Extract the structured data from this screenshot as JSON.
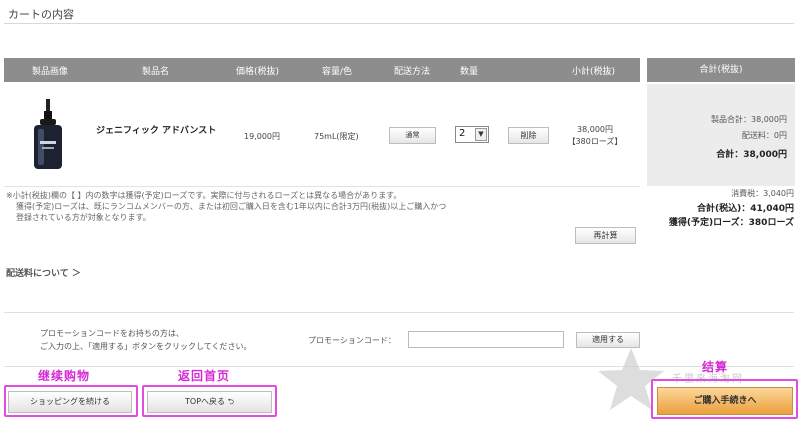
{
  "section": {
    "title": "カートの内容"
  },
  "table": {
    "headers": [
      "製品画像",
      "製品名",
      "価格(税抜)",
      "容量/色",
      "配送方法",
      "数量",
      "小計(税抜)"
    ],
    "summary_header": "合計(税抜)"
  },
  "item": {
    "name": "ジェニフィック アドバンスト",
    "price": "19,000円",
    "volume": "75mL(限定)",
    "shipping_button": "通常",
    "quantity": "2",
    "delete_button": "削除",
    "subtotal": "38,000円",
    "subtotal_points": "【380ローズ】"
  },
  "summary": {
    "product_total": "製品合計：38,000円",
    "shipping_fee": "配送料：0円",
    "total": "合計：38,000円"
  },
  "tax_section": {
    "tax": "消費税：3,040円",
    "grand_total": "合計(税込)：41,040円",
    "roses": "獲得(予定)ローズ：380ローズ"
  },
  "note": {
    "line1": "※小計(税抜)欄の【 】内の数字は獲得(予定)ローズです。実際に付与されるローズとは異なる場合があります。",
    "line2": "獲得(予定)ローズは、既にランコムメンバーの方、または初回ご購入日を含む1年以内に合計3万円(税抜)以上ご購入かつ",
    "line3": "登録されている方が対象となります。"
  },
  "recalc_button": "再計算",
  "shipping_link": "配送料について ＞",
  "promo": {
    "note_line1": "プロモーションコードをお持ちの方は、",
    "note_line2": "ご入力の上、「適用する」ボタンをクリックしてください。",
    "label": "プロモーションコード：",
    "input_value": "",
    "apply_button": "適用する"
  },
  "buttons": {
    "continue_shopping": "ショッピングを続ける",
    "back_to_top": "TOPへ戻る ⮌",
    "checkout": "ご購入手続きへ"
  },
  "annotations": {
    "continue": "继续购物",
    "home": "返回首页",
    "checkout": "结算"
  },
  "watermark": "千里来海淘网",
  "colors": {
    "header_bg": "#8d8d8d",
    "summary_bg": "#ececec",
    "annotation": "#d62ad6",
    "checkout_top": "#fbd79a",
    "checkout_bottom": "#ec9f3c"
  }
}
